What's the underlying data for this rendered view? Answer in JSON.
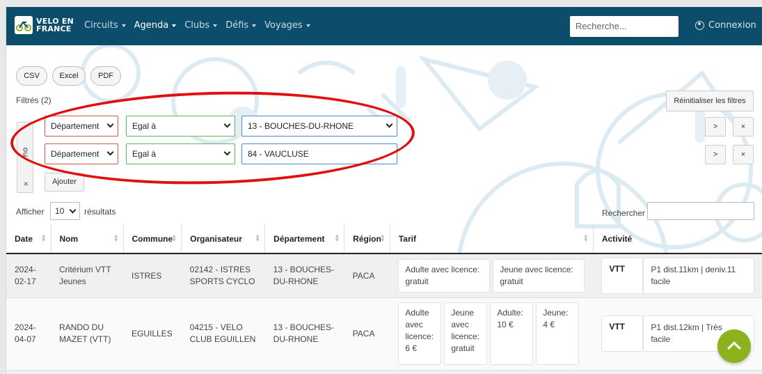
{
  "brand": {
    "line1": "VELO EN",
    "line2": "FRANCE"
  },
  "nav": {
    "items": [
      {
        "label": "Circuits",
        "active": false
      },
      {
        "label": "Agenda",
        "active": true
      },
      {
        "label": "Clubs",
        "active": false
      },
      {
        "label": "Défis",
        "active": false
      },
      {
        "label": "Voyages",
        "active": false
      }
    ],
    "search_placeholder": "Recherche...",
    "login": "Connexion"
  },
  "export": {
    "csv": "CSV",
    "excel": "Excel",
    "pdf": "PDF"
  },
  "filters": {
    "title": "Filtrés (2)",
    "reset": "Réinitialiser les filtres",
    "group_label": "ou",
    "remove": "×",
    "add": "Ajouter",
    "rows": [
      {
        "field": "Département",
        "op": "Egal à",
        "value": "13 - BOUCHES-DU-RHONE",
        "next": ">",
        "remove": "×"
      },
      {
        "field": "Département",
        "op": "Egal à",
        "value": "84 - VAUCLUSE",
        "next": ">",
        "remove": "×"
      }
    ]
  },
  "listing": {
    "show": "Afficher",
    "count": "10",
    "results": "résultats",
    "search_label": "Rechercher"
  },
  "table": {
    "headers": [
      "Date",
      "Nom",
      "Commune",
      "Organisateur",
      "Département",
      "Région",
      "Tarif",
      "Activité"
    ],
    "rows": [
      {
        "date": "2024-02-17",
        "nom": "Critérium VTT Jeunes",
        "commune": "ISTRES",
        "organisateur": "02142 - ISTRES SPORTS CYCLO",
        "departement": "13 - BOUCHES-DU-RHONE",
        "region": "PACA",
        "tarif": [
          "Adulte avec licence: gratuit",
          "Jeune avec licence: gratuit"
        ],
        "activite": {
          "type": "VTT",
          "desc1": "P1 dist.11km | deniv.11",
          "desc2": "facile"
        }
      },
      {
        "date": "2024-04-07",
        "nom": "RANDO DU MAZET (VTT)",
        "commune": "EGUILLES",
        "organisateur": "04215 - VELO CLUB EGUILLEN",
        "departement": "13 - BOUCHES-DU-RHONE",
        "region": "PACA",
        "tarif": [
          "Adulte avec licence: 6 €",
          "Jeune avec licence: gratuit",
          "Adulte: 10 €",
          "Jeune: 4 €"
        ],
        "activite": {
          "type": "VTT",
          "desc1": "P1 dist.12km | Très",
          "desc2": "facile"
        }
      }
    ]
  },
  "colors": {
    "navbar": "#0c4d6c",
    "accent_green": "#8cb31e",
    "ellipse_red": "#e01010"
  }
}
